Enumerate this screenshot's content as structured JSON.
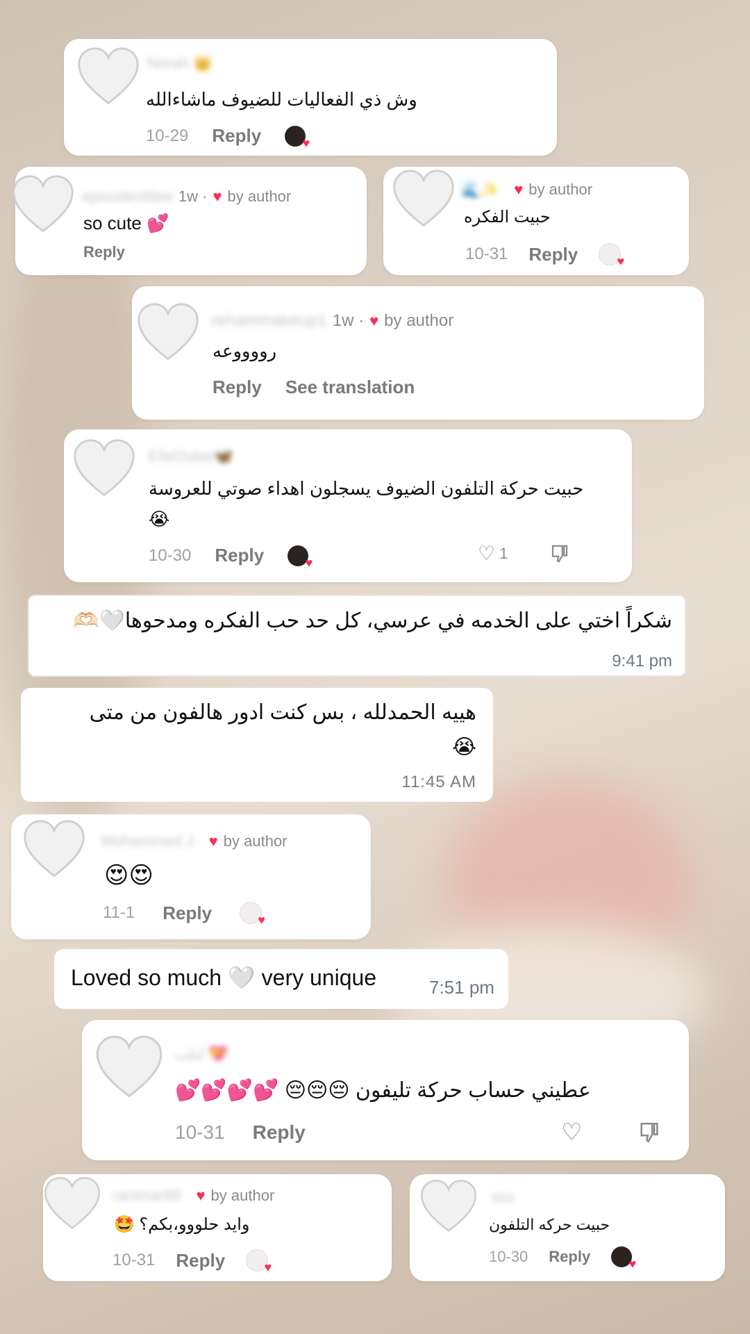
{
  "comments": [
    {
      "username": "Norah 👑",
      "text": "وش ذي الفعاليات للضيوف ماشاءالله",
      "date": "10-29",
      "reply": "Reply"
    },
    {
      "username": "episodesfdee",
      "time": "1w ·",
      "author_label": "by author",
      "text": "so cute 💕",
      "reply": "Reply"
    },
    {
      "username": "🌊✨ ·",
      "author_label": "by author",
      "text": "حبيت الفكره",
      "date": "10-31",
      "reply": "Reply"
    },
    {
      "username": "rehammakeup1",
      "time": "1w ·",
      "author_label": "by author",
      "text": "رووووعه",
      "reply": "Reply",
      "translate": "See translation"
    },
    {
      "username": "ElleDubai🦋",
      "text": "حبيت حركة التلفون الضيوف يسجلون اهداء صوتي للعروسة",
      "emoji": "😭",
      "date": "10-30",
      "reply": "Reply",
      "likes": "1"
    },
    {
      "username": "Mohammed J ·",
      "author_label": "by author",
      "text": "😍😍",
      "date": "11-1",
      "reply": "Reply"
    },
    {
      "username": "لبلب 💝",
      "text": "عطيني حساب حركة تليفون 😔😔😔 💕💕💕💕",
      "date": "10-31",
      "reply": "Reply"
    },
    {
      "username": "ranimar88 ·",
      "author_label": "by author",
      "text": "وايد حلووو،بكم؟ 🤩",
      "date": "10-31",
      "reply": "Reply"
    },
    {
      "username": "sss",
      "text": "حبيت حركه التلفون",
      "date": "10-30",
      "reply": "Reply"
    }
  ],
  "messages": [
    {
      "text": "شكراً اختي على الخدمه في عرسي، كل حد حب الفكره ومدحوها🤍🫶🏻",
      "time": "9:41 pm"
    },
    {
      "text": "هييه الحمدلله ، بس كنت ادور هالفون من متى",
      "emoji": "😭",
      "time": "11:45 AM"
    },
    {
      "text": "Loved so much 🤍 very unique",
      "time": "7:51 pm"
    }
  ]
}
